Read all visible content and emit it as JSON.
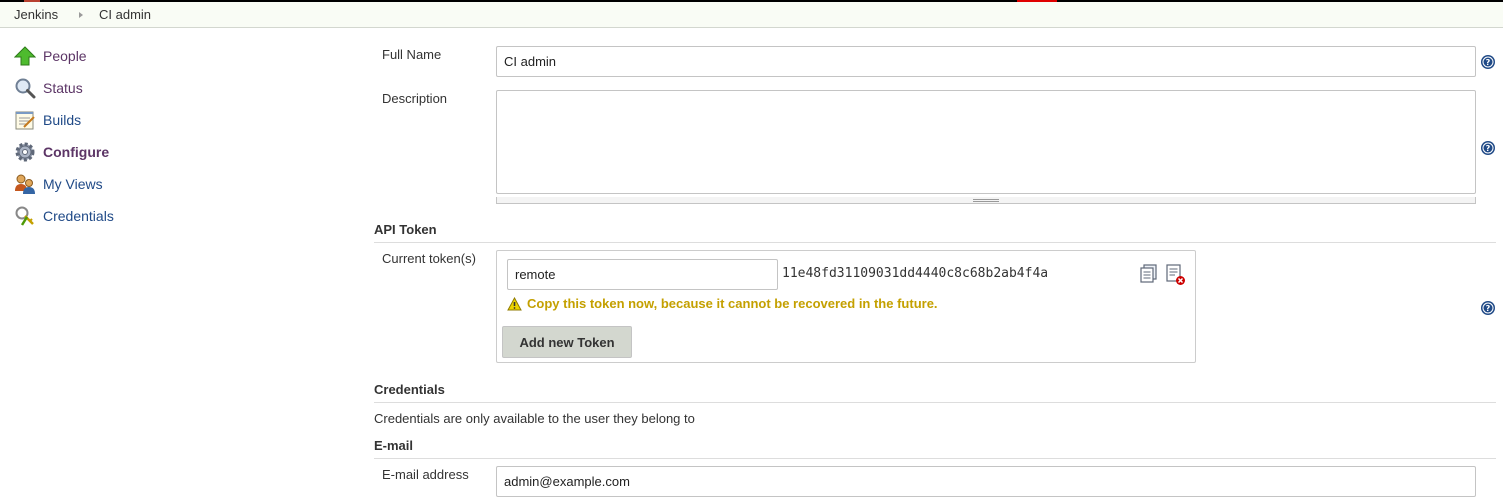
{
  "breadcrumb": {
    "items": [
      "Jenkins",
      "CI admin"
    ]
  },
  "sidebar": {
    "items": [
      {
        "label": "People",
        "icon": "people-arrow-icon"
      },
      {
        "label": "Status",
        "icon": "magnifier-icon"
      },
      {
        "label": "Builds",
        "icon": "notepad-icon"
      },
      {
        "label": "Configure",
        "icon": "gear-icon"
      },
      {
        "label": "My Views",
        "icon": "user-group-icon"
      },
      {
        "label": "Credentials",
        "icon": "keys-icon"
      }
    ]
  },
  "form": {
    "full_name": {
      "label": "Full Name",
      "value": "CI admin"
    },
    "description": {
      "label": "Description",
      "value": ""
    },
    "api_token": {
      "section_title": "API Token",
      "current_label": "Current token(s)",
      "token_name": "remote",
      "token_value": "11e48fd31109031dd4440c8c68b2ab4f4a",
      "warning": "Copy this token now, because it cannot be recovered in the future.",
      "add_button": "Add new Token"
    },
    "credentials": {
      "section_title": "Credentials",
      "note": "Credentials are only available to the user they belong to"
    },
    "email": {
      "section_title": "E-mail",
      "label": "E-mail address",
      "value": "admin@example.com"
    }
  },
  "colors": {
    "link": "#204a87",
    "visited": "#5c3566",
    "warning": "#c4a000",
    "help": "#204a87",
    "breadcrumb_bg": "#f9fcf5"
  }
}
